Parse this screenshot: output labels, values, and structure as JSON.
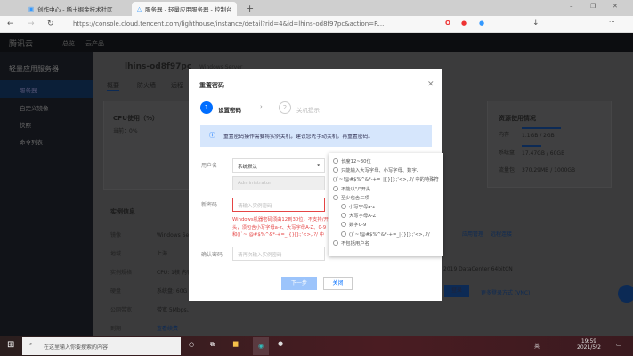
{
  "browser": {
    "tabs": [
      {
        "label": "创作中心 - 稀土掘金技术社区"
      },
      {
        "label": "服务器 - 轻量应用服务器 - 控制台"
      }
    ],
    "url": "https://console.cloud.tencent.com/lighthouse/instance/detail?rid=4&id=lhins-od8f97pc&action=R..."
  },
  "console": {
    "logo": "腾讯云",
    "nav": [
      "总览",
      "云产品"
    ],
    "sidebar_title": "轻量应用服务器",
    "sidebar": [
      "服务器",
      "自定义镜像",
      "快照",
      "命令列表"
    ],
    "instance_id": "lhins-od8f97pc",
    "instance_sub": "Windows Server",
    "tabs": [
      "概要",
      "防火墙",
      "远程"
    ],
    "cpu_title": "CPU使用（%）",
    "cpu_sub": "当前：0%",
    "info_title": "实例信息",
    "info_rows": [
      [
        "镜像",
        "Windows Se"
      ],
      [
        "地域",
        "上海"
      ],
      [
        "实例规格",
        "CPU: 1核 内存"
      ],
      [
        "硬盘",
        "系统盘: 60G"
      ],
      [
        "公网带宽",
        "带宽 5Mbps、流量包"
      ],
      [
        "到期",
        "查看续费"
      ]
    ],
    "res_title": "资源使用情况",
    "res": [
      {
        "label": "内存",
        "value": "1.1GB / 2GB",
        "pct": 55
      },
      {
        "label": "系统盘",
        "value": "17.47GB / 60GB",
        "pct": 29
      },
      {
        "label": "流量包",
        "value": "370.29MB / 1000GB",
        "pct": 0
      }
    ],
    "links": [
      "应用管理",
      "远程连接"
    ],
    "os_text": "2019 DataCenter 64bitCN",
    "btn": "登录",
    "alt_link": "更多登录方式 (VNC)"
  },
  "modal": {
    "title": "重置密码",
    "steps": [
      {
        "num": "1",
        "label": "设置密码"
      },
      {
        "num": "2",
        "label": "关机提示"
      }
    ],
    "info": "重置密码操作需要将实例关机，建议您先手动关机，再重置密码。",
    "username_label": "用户名",
    "username_select": "系统默认",
    "username_value": "Administrator",
    "newpw_label": "新密码",
    "newpw_placeholder": "请输入实例密码",
    "error": "Windows机器密码须由12到30位，不支持/开头，须包含小写字母a-z、大写字母A-Z、0-9和()`~!@#$%^&*-+=_|{}[]:;'<>,.?/ 中的至少三项，不能包含用户名，如：“administrator”（大小写不敏感）",
    "confirm_label": "确认密码",
    "confirm_placeholder": "请再次输入实例密码",
    "next": "下一步",
    "close": "关闭"
  },
  "rules": [
    "长度12~30位",
    "只能输入大写字母、小写字母、数字、",
    "()`~!@#$%^&*-+=_|{}[]:;'<>,.?/ 中的特殊符号",
    "不能以\"/\"开头",
    "至少包含三项",
    "小写字母a-z",
    "大写字母A-Z",
    "数字0-9",
    "()`~!@#$%^&*-+=_|{}[]:;'<>,.?/",
    "不包括用户名"
  ],
  "taskbar": {
    "search": "在这里输入你要搜索的内容",
    "time": "19:59",
    "date": "2021/5/2",
    "ime": "英"
  },
  "colors": {
    "accent": "#006eff",
    "error": "#e54545"
  }
}
